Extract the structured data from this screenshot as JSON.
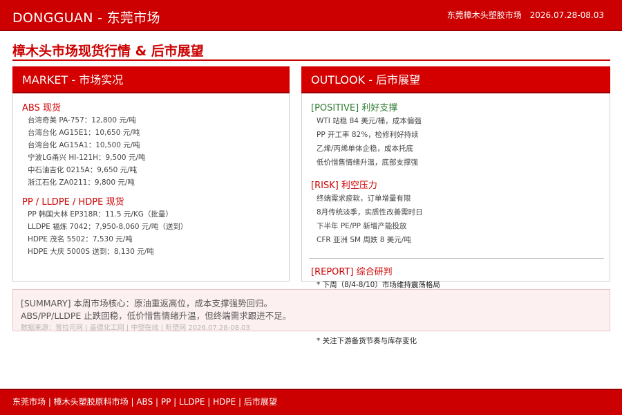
{
  "header": {
    "brand": "DONGGUAN - 东莞市场",
    "market": "东莞樟木头塑胶市场",
    "date_range": "2026.07.28-08.03"
  },
  "page_title": "樟木头市场现货行情 & 后市展望",
  "market_panel": {
    "title": "MARKET - 市场实况",
    "abs": {
      "title": "ABS 现货",
      "items": [
        "台湾奇美 PA-757：12,800 元/吨",
        "台湾台化 AG15E1：10,650 元/吨",
        "台湾台化 AG15A1：10,500 元/吨",
        "宁波LG甬兴 HI-121H：9,500 元/吨",
        "中石油吉化 0215A：9,650 元/吨",
        "浙江石化 ZA0211：9,800 元/吨"
      ]
    },
    "pe": {
      "title": "PP / LLDPE / HDPE 现货",
      "items": [
        "PP 韩国大林 EP318R：11.5 元/KG（批量）",
        "LLDPE 福炼 7042：7,950-8,060 元/吨（送到）",
        "HDPE 茂名 5502：7,530 元/吨",
        "HDPE 大庆 5000S 送到：8,130 元/吨"
      ]
    }
  },
  "outlook_panel": {
    "title": "OUTLOOK - 后市展望",
    "positive": {
      "title": "[POSITIVE] 利好支撑",
      "items": [
        "WTI 站稳 84 美元/桶，成本偏强",
        "PP 开工率 82%，检修利好持续",
        "乙烯/丙烯单体企稳，成本托底",
        "低价惜售情绪升温，底部支撑强"
      ]
    },
    "risk": {
      "title": "[RISK] 利空压力",
      "items": [
        "终端需求疲软，订单增量有限",
        "8月传统淡季，实质性改善需时日",
        "下半年 PE/PP 新增产能投放",
        "CFR 亚洲 SM 周跌 8 美元/吨"
      ]
    },
    "report": {
      "title": "[REPORT] 综合研判",
      "items": [
        "* 下周（8/4-8/10）市场维持震荡格局",
        "* 关注下游备货节奏与库存变化"
      ]
    }
  },
  "summary": {
    "line1": "[SUMMARY] 本周市场核心：原油重返高位，成本支撑强势回归。",
    "line2": "ABS/PP/LLDPE 止跌回稳，低价惜售情绪升温，但终端需求跟进不足。",
    "sources": "数据来源：普拉司网 | 盖德化工网 | 中塑在线 | 昕塑网  2026.07.28-08.03"
  },
  "footer": {
    "text": "东莞市场 | 樟木头塑胶原料市场 | ABS | PP | LLDPE | HDPE | 后市展望"
  },
  "colors": {
    "brand_red": "#cc0000",
    "dark_red": "#990000",
    "positive_green": "#2e7d32",
    "summary_bg": "#fdf0f0"
  }
}
